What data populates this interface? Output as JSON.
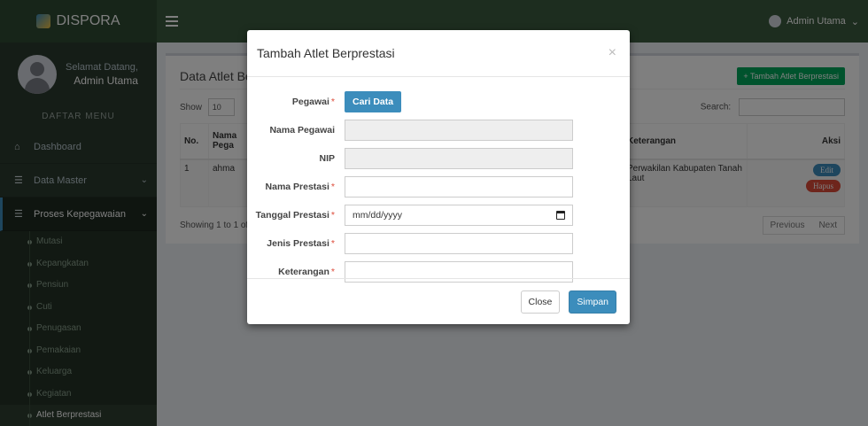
{
  "brand": {
    "name": "DISPORA"
  },
  "user_panel": {
    "greeting": "Selamat Datang,",
    "name": "Admin Utama"
  },
  "menu_header": "DAFTAR MENU",
  "menu": [
    {
      "label": "Dashboard",
      "icon": "home-icon"
    },
    {
      "label": "Data Master",
      "icon": "list-icon"
    },
    {
      "label": "Proses Kepegawaian",
      "icon": "list-icon"
    }
  ],
  "submenu": [
    "Mutasi",
    "Kepangkatan",
    "Pensiun",
    "Cuti",
    "Penugasan",
    "Pemakaian",
    "Keluarga",
    "Kegiatan",
    "Atlet Berprestasi"
  ],
  "topbar": {
    "user": "Admin Utama"
  },
  "page": {
    "title": "Data Atlet Be",
    "add_button": "+ Tambah Atlet Berprestasi",
    "show_label": "Show",
    "show_value": "10",
    "search_label": "Search:",
    "columns": [
      "No.",
      "Nama Pega",
      "Keterangan",
      "Aksi"
    ],
    "row": {
      "no": "1",
      "nama": "ahma",
      "keterangan": "Perwakilan Kabupaten Tanah Laut"
    },
    "edit_label": "Edit",
    "delete_label": "Hapus",
    "info": "Showing 1 to 1 of",
    "prev": "Previous",
    "next": "Next"
  },
  "modal": {
    "title": "Tambah Atlet Berprestasi",
    "close_symbol": "×",
    "pegawai_label": "Pegawai",
    "cari_data": "Cari Data",
    "nama_pegawai_label": "Nama Pegawai",
    "nip_label": "NIP",
    "nama_prestasi_label": "Nama Prestasi",
    "tanggal_prestasi_label": "Tanggal Prestasi",
    "tanggal_placeholder": "mm/dd/yyyy",
    "jenis_prestasi_label": "Jenis Prestasi",
    "keterangan_label": "Keterangan",
    "required_mark": "*",
    "close_button": "Close",
    "save_button": "Simpan"
  }
}
